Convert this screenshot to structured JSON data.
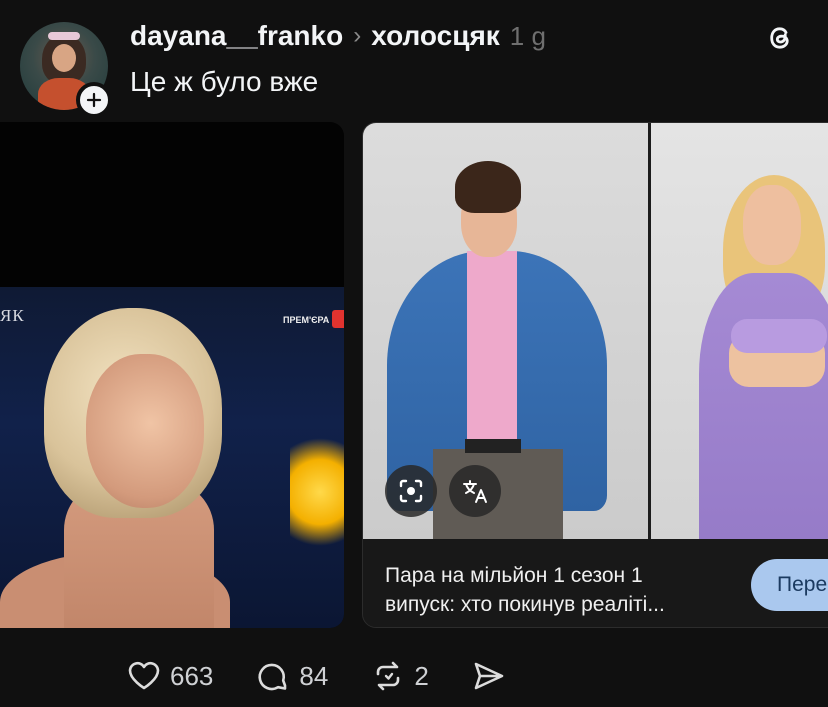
{
  "post": {
    "username": "dayana__franko",
    "separator": "›",
    "channel": "холосцяк",
    "time": "1 g",
    "text": "Це ж було вже"
  },
  "media_left": {
    "tv_logo": "ЯК",
    "premiere_label": "ПРЕМ'ЄРА"
  },
  "link_card": {
    "title_line1": "Пара на мільйон 1 сезон 1",
    "title_line2": "випуск: хто покинув реаліті...",
    "open_label": "Пере"
  },
  "actions": {
    "likes": "663",
    "replies": "84",
    "reposts": "2"
  },
  "icons": {
    "follow": "plus-icon",
    "app": "threads-logo-icon",
    "lens": "lens-icon",
    "translate": "translate-icon",
    "like": "heart-icon",
    "reply": "comment-icon",
    "repost": "repost-icon",
    "share": "send-icon"
  },
  "colors": {
    "background": "#101010",
    "text": "#f3f5f7",
    "muted": "#6f6f6f",
    "open_button": "#aac8ee"
  }
}
